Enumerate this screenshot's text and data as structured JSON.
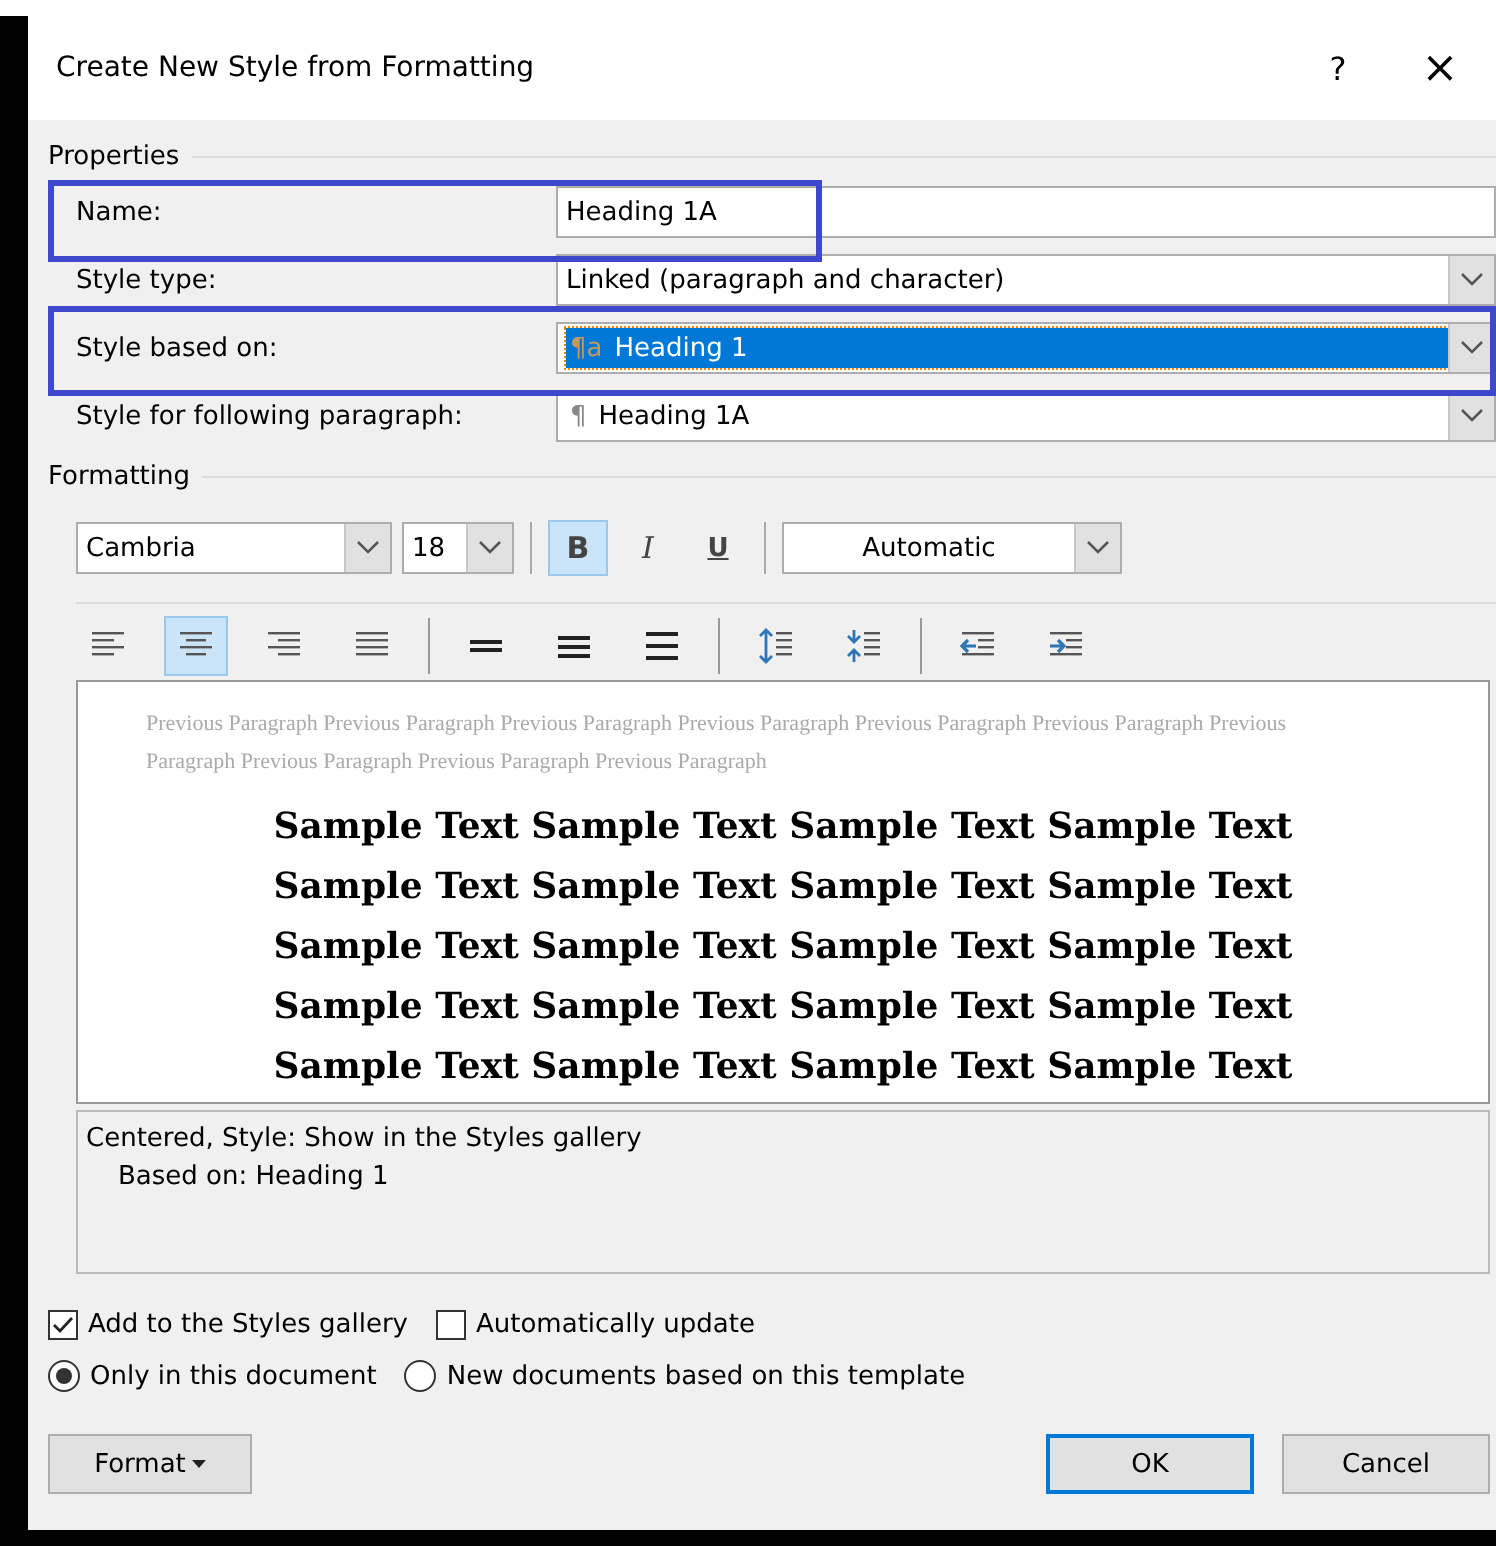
{
  "window": {
    "title": "Create New Style from Formatting",
    "help": "?",
    "close": "×"
  },
  "properties": {
    "heading": "Properties",
    "fields": [
      {
        "kind": "text",
        "label": "Name:",
        "value": "Heading 1A",
        "selected": false
      },
      {
        "kind": "dropdown",
        "label": "Style type:",
        "value": "Linked (paragraph and character)",
        "selected": false
      },
      {
        "kind": "dropdown",
        "label": "Style based on:",
        "value": "Heading 1",
        "icon": "¶a",
        "selected": true
      },
      {
        "kind": "dropdown",
        "label": "Style for following paragraph:",
        "value": "Heading 1A",
        "icon": "¶",
        "selected": false
      }
    ]
  },
  "formatting": {
    "heading": "Formatting",
    "font": "Cambria",
    "size": "18",
    "styles": [
      {
        "kind": "bold",
        "label": "B",
        "selected": true
      },
      {
        "kind": "italic",
        "label": "I",
        "selected": false
      },
      {
        "kind": "underline",
        "label": "U",
        "selected": false
      }
    ],
    "font_color": "Automatic",
    "paragraph_buttons": [
      {
        "kind": "align-left",
        "selected": false
      },
      {
        "kind": "align-center",
        "selected": true
      },
      {
        "kind": "align-right",
        "selected": false
      },
      {
        "kind": "justify",
        "selected": false
      },
      {
        "kind": "sep"
      },
      {
        "kind": "single-spacing",
        "selected": false
      },
      {
        "kind": "one-half-spacing",
        "selected": false
      },
      {
        "kind": "double-spacing",
        "selected": false
      },
      {
        "kind": "sep"
      },
      {
        "kind": "increase-spacing",
        "selected": false
      },
      {
        "kind": "decrease-spacing",
        "selected": false
      },
      {
        "kind": "sep"
      },
      {
        "kind": "decrease-indent",
        "selected": false
      },
      {
        "kind": "increase-indent",
        "selected": false
      }
    ]
  },
  "preview": {
    "previous": "Previous Paragraph Previous Paragraph Previous Paragraph Previous Paragraph Previous Paragraph Previous Paragraph Previous Paragraph Previous Paragraph Previous Paragraph Previous Paragraph",
    "lines": [
      "Sample Text Sample Text Sample Text Sample Text",
      "Sample Text Sample Text Sample Text Sample Text",
      "Sample Text Sample Text Sample Text Sample Text",
      "Sample Text Sample Text Sample Text Sample Text",
      "Sample Text Sample Text Sample Text Sample Text"
    ]
  },
  "description": [
    "Centered, Style: Show in the Styles gallery",
    "Based on: Heading 1"
  ],
  "checkboxes": [
    {
      "label": "Add to the Styles gallery",
      "checked": true
    },
    {
      "label": "Automatically update",
      "checked": false
    }
  ],
  "radios": [
    {
      "label": "Only in this document",
      "selected": true
    },
    {
      "label": "New documents based on this template",
      "selected": false
    }
  ],
  "buttons": {
    "format": "Format",
    "ok": "OK",
    "cancel": "Cancel"
  }
}
